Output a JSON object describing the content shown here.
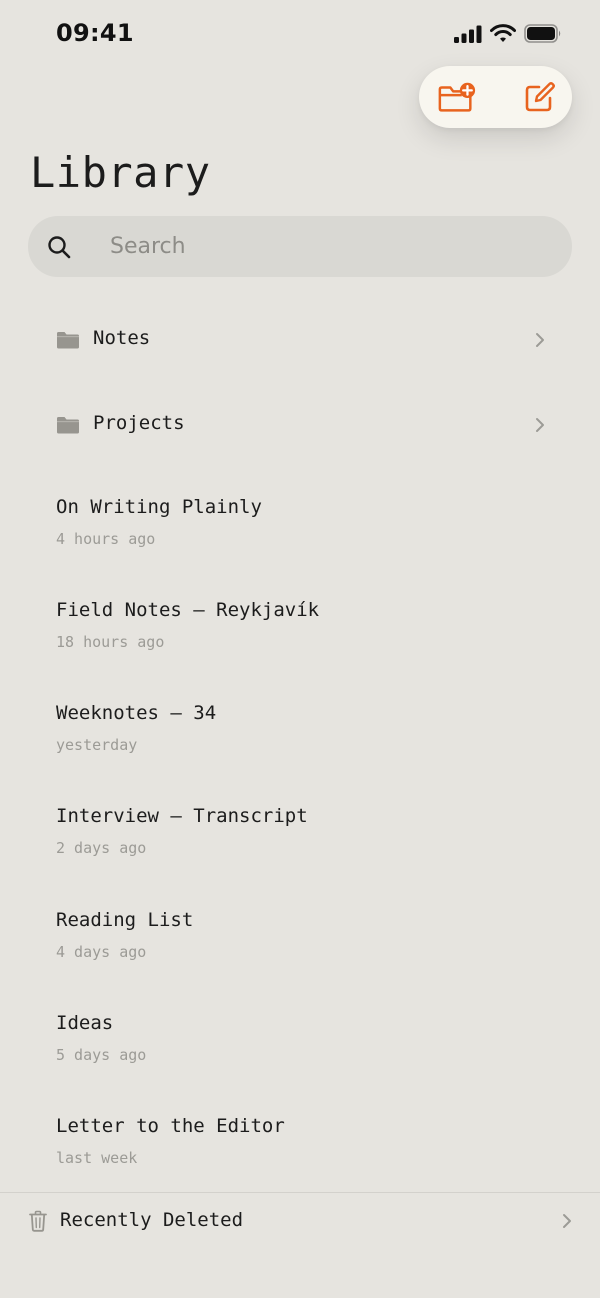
{
  "status_bar": {
    "time": "09:41"
  },
  "toolbar": {
    "accent_color": "#e8631e",
    "new_folder_icon": "folder-plus-icon",
    "compose_icon": "compose-icon"
  },
  "page": {
    "title": "Library"
  },
  "search": {
    "placeholder": "Search",
    "value": ""
  },
  "folders": [
    {
      "label": "Notes"
    },
    {
      "label": "Projects"
    }
  ],
  "notes": [
    {
      "title": "On Writing Plainly",
      "time": "4 hours ago"
    },
    {
      "title": "Field Notes — Reykjavík",
      "time": "18 hours ago"
    },
    {
      "title": "Weeknotes — 34",
      "time": "yesterday"
    },
    {
      "title": "Interview — Transcript",
      "time": "2 days ago"
    },
    {
      "title": "Reading List",
      "time": "4 days ago"
    },
    {
      "title": "Ideas",
      "time": "5 days ago"
    },
    {
      "title": "Letter to the Editor",
      "time": "last week"
    }
  ],
  "footer": {
    "label": "Recently Deleted"
  }
}
